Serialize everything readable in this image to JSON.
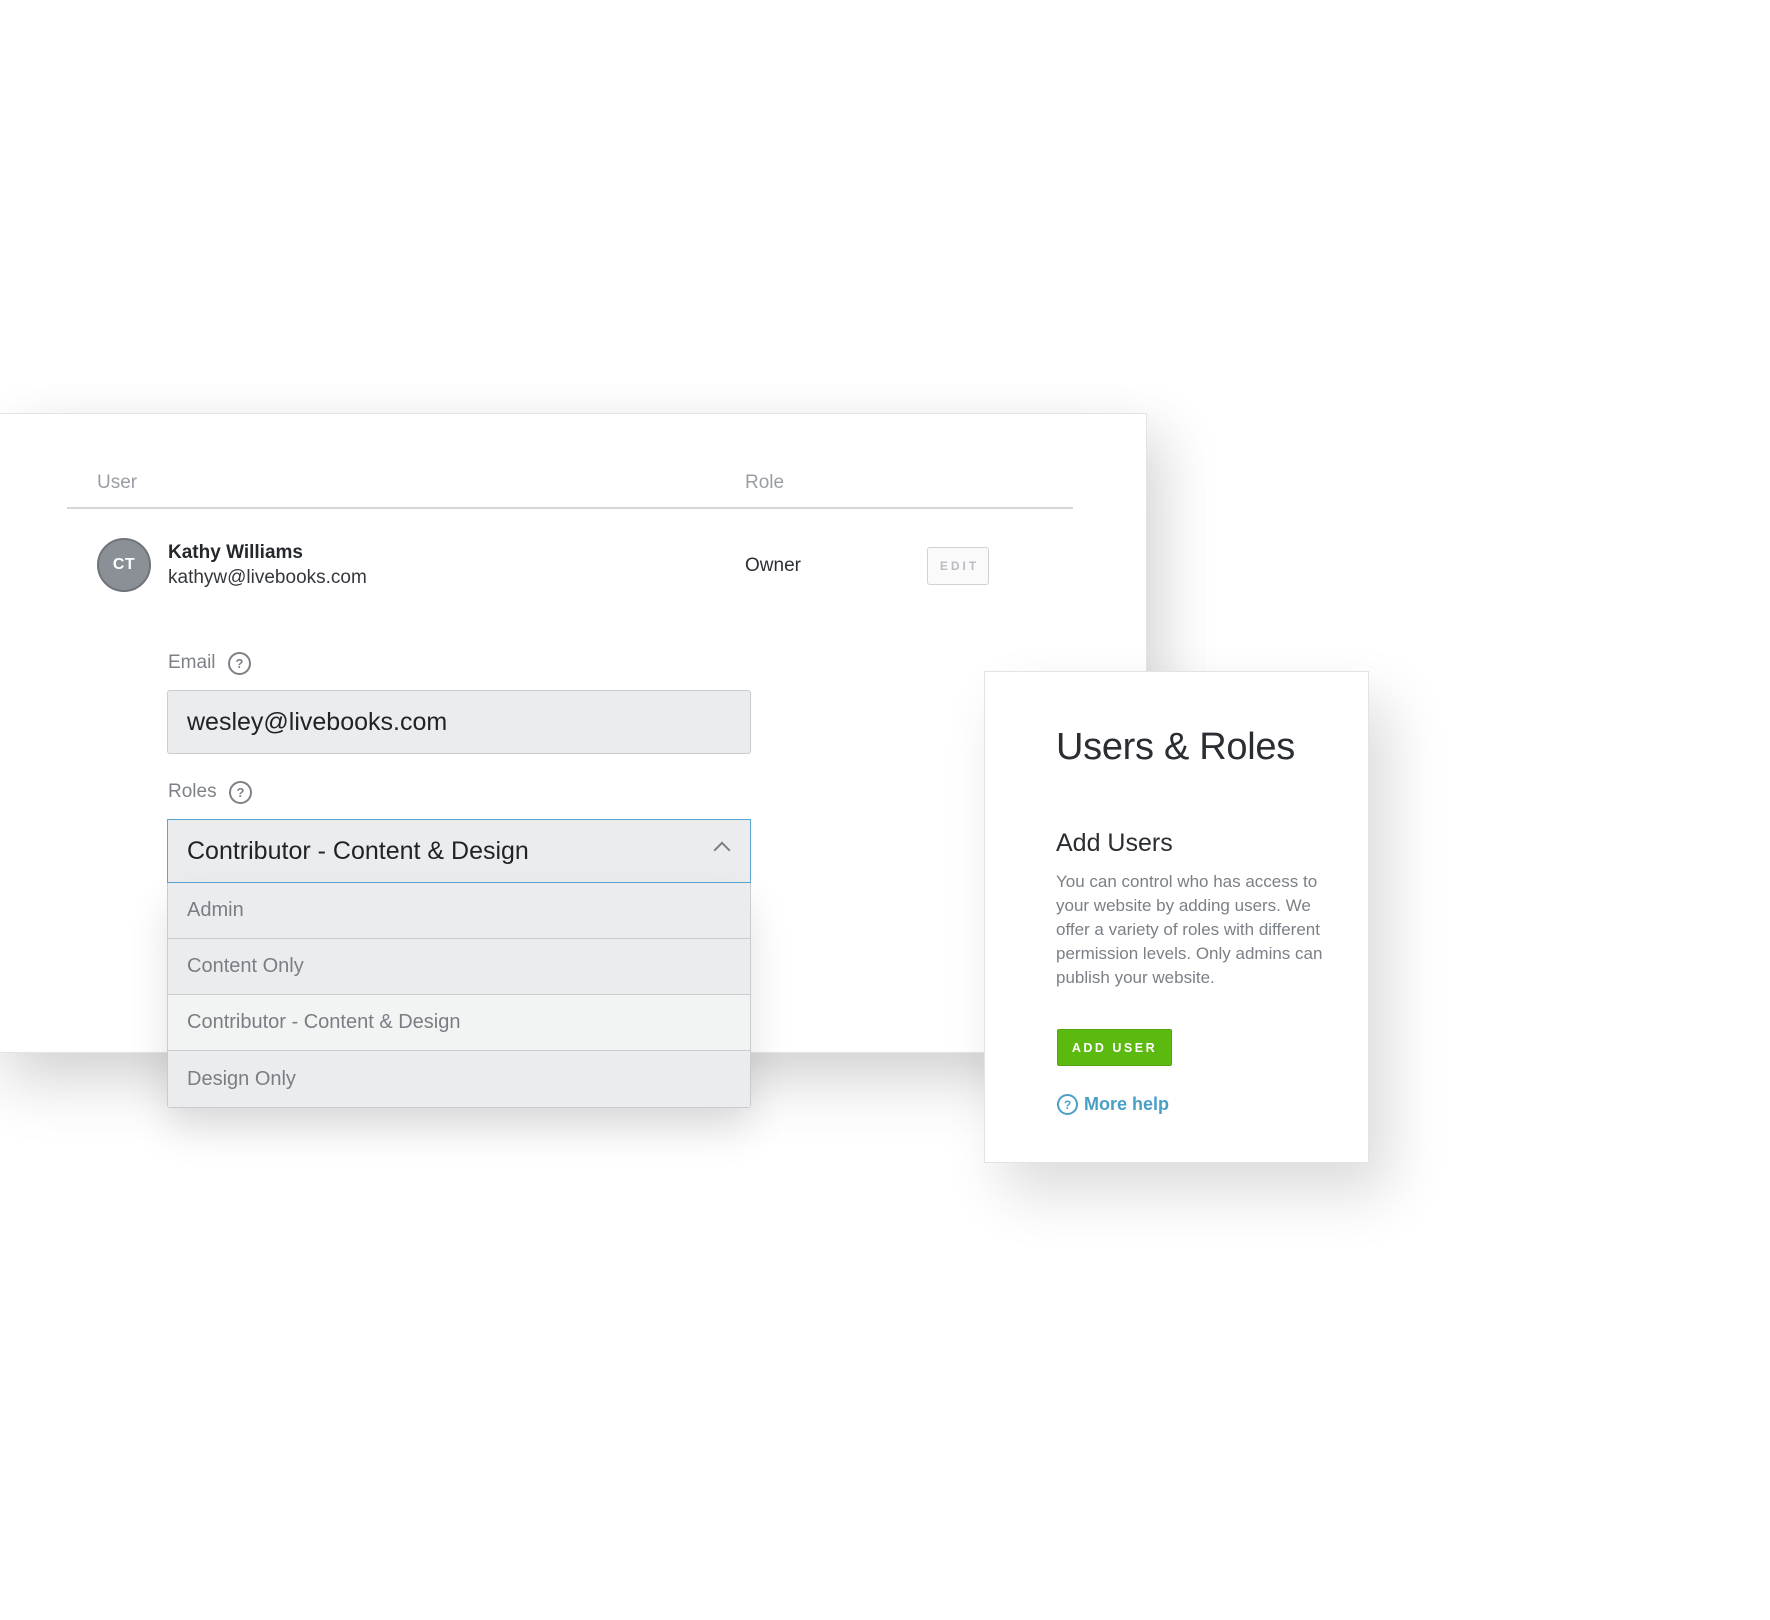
{
  "table": {
    "headers": {
      "user": "User",
      "role": "Role"
    },
    "rows": [
      {
        "initials": "CT",
        "name": "Kathy Williams",
        "email": "kathyw@livebooks.com",
        "role": "Owner",
        "edit_label": "EDIT"
      }
    ]
  },
  "form": {
    "email_label": "Email",
    "email_value": "wesley@livebooks.com",
    "roles_label": "Roles",
    "role_selected": "Contributor - Content & Design",
    "role_options": [
      "Admin",
      "Content Only",
      "Contributor - Content & Design",
      "Design Only"
    ],
    "help_icon": "?"
  },
  "help_panel": {
    "title": "Users & Roles",
    "subtitle": "Add Users",
    "body": "You can control who has access to your website by adding users. We offer a variety of roles with different permission levels. Only admins can publish your website.",
    "add_user_label": "ADD USER",
    "more_help_label": "More help",
    "more_help_icon": "?"
  },
  "colors": {
    "accent_green": "#5cb90f",
    "link_blue": "#4a9fc6",
    "focus_blue": "#5aa6cf"
  }
}
